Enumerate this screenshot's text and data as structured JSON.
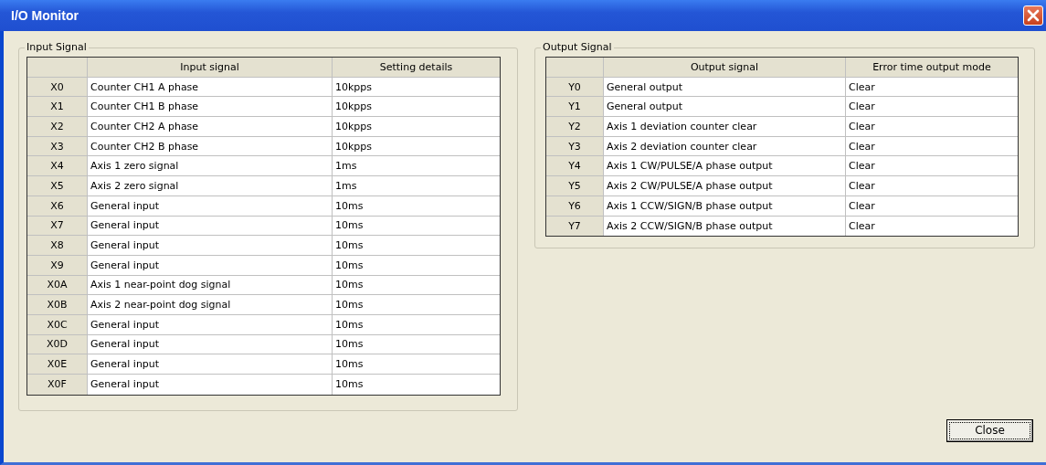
{
  "window": {
    "title": "I/O Monitor"
  },
  "input_signal": {
    "title": "Input Signal",
    "columns": [
      "Input signal",
      "Setting details"
    ],
    "rows": [
      {
        "device": "X0",
        "signal": "Counter CH1 A phase",
        "value": "10kpps"
      },
      {
        "device": "X1",
        "signal": "Counter CH1 B phase",
        "value": "10kpps"
      },
      {
        "device": "X2",
        "signal": "Counter CH2 A phase",
        "value": "10kpps"
      },
      {
        "device": "X3",
        "signal": "Counter CH2 B phase",
        "value": "10kpps"
      },
      {
        "device": "X4",
        "signal": "Axis 1 zero signal",
        "value": "1ms"
      },
      {
        "device": "X5",
        "signal": "Axis 2 zero signal",
        "value": "1ms"
      },
      {
        "device": "X6",
        "signal": "General input",
        "value": "10ms"
      },
      {
        "device": "X7",
        "signal": "General input",
        "value": "10ms"
      },
      {
        "device": "X8",
        "signal": "General input",
        "value": "10ms"
      },
      {
        "device": "X9",
        "signal": "General input",
        "value": "10ms"
      },
      {
        "device": "X0A",
        "signal": "Axis 1 near-point dog signal",
        "value": "10ms"
      },
      {
        "device": "X0B",
        "signal": "Axis 2 near-point dog signal",
        "value": "10ms"
      },
      {
        "device": "X0C",
        "signal": "General input",
        "value": "10ms"
      },
      {
        "device": "X0D",
        "signal": "General input",
        "value": "10ms"
      },
      {
        "device": "X0E",
        "signal": "General input",
        "value": "10ms"
      },
      {
        "device": "X0F",
        "signal": "General input",
        "value": "10ms"
      }
    ]
  },
  "output_signal": {
    "title": "Output Signal",
    "columns": [
      "Output signal",
      "Error time output mode"
    ],
    "rows": [
      {
        "device": "Y0",
        "signal": "General output",
        "value": "Clear"
      },
      {
        "device": "Y1",
        "signal": "General output",
        "value": "Clear"
      },
      {
        "device": "Y2",
        "signal": "Axis 1 deviation counter clear",
        "value": "Clear"
      },
      {
        "device": "Y3",
        "signal": "Axis 2 deviation counter clear",
        "value": "Clear"
      },
      {
        "device": "Y4",
        "signal": "Axis 1 CW/PULSE/A phase output",
        "value": "Clear"
      },
      {
        "device": "Y5",
        "signal": "Axis 2 CW/PULSE/A phase output",
        "value": "Clear"
      },
      {
        "device": "Y6",
        "signal": "Axis 1 CCW/SIGN/B phase output",
        "value": "Clear"
      },
      {
        "device": "Y7",
        "signal": "Axis 2 CCW/SIGN/B phase output",
        "value": "Clear"
      }
    ]
  },
  "buttons": [
    "Close"
  ]
}
